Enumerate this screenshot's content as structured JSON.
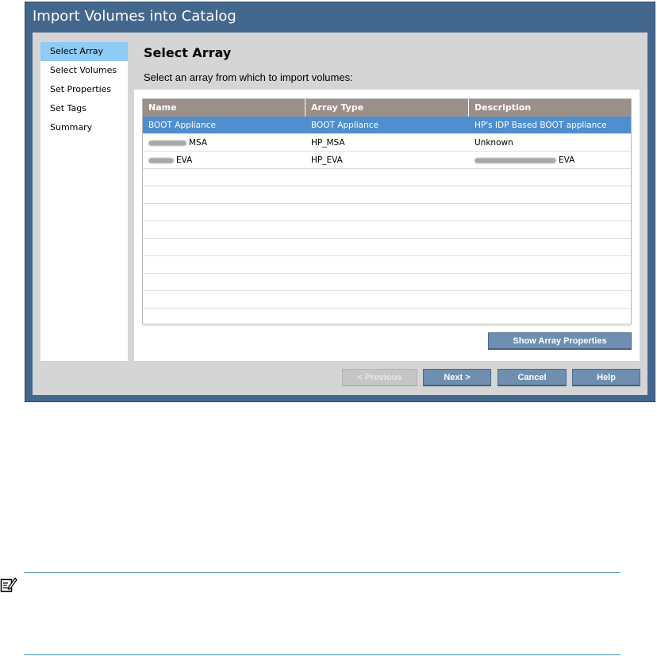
{
  "dialog": {
    "title": "Import Volumes into Catalog"
  },
  "sidebar": {
    "items": [
      {
        "label": "Select Array",
        "active": true
      },
      {
        "label": "Select Volumes",
        "active": false
      },
      {
        "label": "Set Properties",
        "active": false
      },
      {
        "label": "Set Tags",
        "active": false
      },
      {
        "label": "Summary",
        "active": false
      }
    ]
  },
  "main": {
    "heading": "Select Array",
    "instruction": "Select an array from which to import volumes:"
  },
  "table": {
    "headers": [
      "Name",
      "Array Type",
      "Description"
    ],
    "rows": [
      {
        "name": "BOOT Appliance",
        "type": "BOOT Appliance",
        "description": "HP's IDP Based BOOT appliance",
        "selected": true
      },
      {
        "name": "MSA",
        "type": "HP_MSA",
        "description": "Unknown",
        "selected": false
      },
      {
        "name": "EVA",
        "type": "HP_EVA",
        "description": "EVA",
        "selected": false
      }
    ],
    "empty_rows": 9
  },
  "buttons": {
    "show_props": "Show Array Properties",
    "previous": "< Previous",
    "next": "Next >",
    "cancel": "Cancel",
    "help": "Help"
  },
  "icons": {
    "note": "note-pencil-icon"
  },
  "colors": {
    "frame": "#44678d",
    "selected_row": "#4f8ecf",
    "active_step": "#8ecbf5",
    "table_header": "#9a8f89",
    "button": "#6f8fb1"
  }
}
